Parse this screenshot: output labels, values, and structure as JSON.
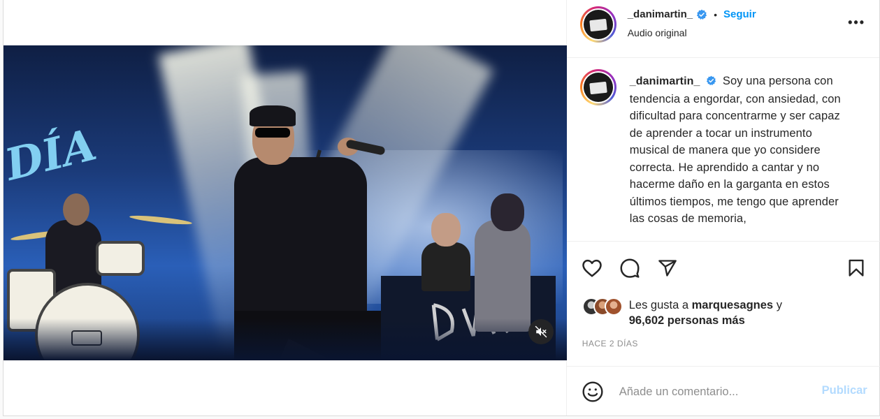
{
  "post": {
    "username": "_danimartin_",
    "follow_label": "Seguir",
    "audio_label": "Audio original",
    "more_label": "•••",
    "caption_text": "Soy una persona con tendencia a engordar, con ansiedad, con dificultad para concentrarme y ser capaz de aprender a tocar un instrumento musical de manera que yo considere correcta. He aprendido a cantar y no hacerme daño en la garganta en estos últimos tiempos, me tengo que aprender las cosas de memoria,",
    "likes_prefix": "Les gusta a",
    "likes_user": "marquesagnes",
    "likes_conj": "y",
    "likes_count_text": "96,602 personas más",
    "time_ago": "HACE 2 DÍAS",
    "comment_placeholder": "Añade un comentario...",
    "publish_label": "Publicar"
  },
  "video": {
    "muted": true,
    "stage_graffiti": "DÍA"
  },
  "colors": {
    "accent_blue": "#0095f6",
    "publish_disabled": "#b3dbff",
    "secondary_text": "#8e8e8e"
  },
  "icons": {
    "verified": "verified-badge-icon",
    "like": "heart-icon",
    "comment": "comment-bubble-icon",
    "share": "paper-plane-icon",
    "save": "bookmark-icon",
    "mute": "speaker-muted-icon",
    "emoji": "smiley-icon",
    "more": "ellipsis-icon"
  }
}
